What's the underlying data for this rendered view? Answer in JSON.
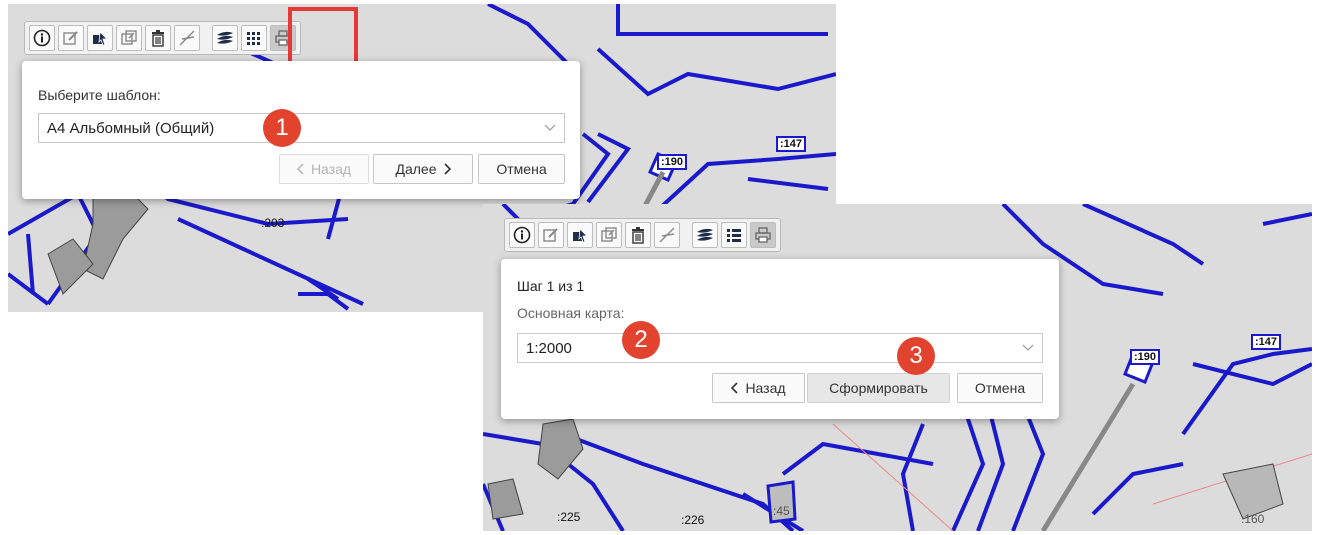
{
  "toolbar": {
    "buttons": [
      {
        "icon": "info-icon"
      },
      {
        "icon": "edit-icon"
      },
      {
        "icon": "select-object-icon"
      },
      {
        "icon": "export-icon"
      },
      {
        "icon": "trash-icon"
      },
      {
        "icon": "measure-icon"
      },
      {
        "icon": "layers-icon"
      },
      {
        "icon": "list-icon"
      },
      {
        "icon": "print-icon"
      }
    ]
  },
  "dialog1": {
    "label": "Выберите шаблон:",
    "template_value": "А4 Альбомный (Общий)",
    "back_label": "Назад",
    "next_label": "Далее",
    "cancel_label": "Отмена"
  },
  "dialog2": {
    "step_text": "Шаг 1 из 1",
    "map_label": "Основная карта:",
    "scale_value": "1:2000",
    "back_label": "Назад",
    "generate_label": "Сформировать",
    "cancel_label": "Отмена"
  },
  "badges": [
    "1",
    "2",
    "3"
  ],
  "map_labels_panel1": {
    "l190": ":190",
    "l147": ":147",
    "l203": ":203"
  },
  "map_labels_panel2": {
    "l190": ":190",
    "l147": ":147",
    "l225": ":225",
    "l226": ":226",
    "l45": ":45",
    "l160": ":160"
  },
  "colors": {
    "parcel_line": "#1a1acc",
    "highlight": "#e53935",
    "badge": "#e2432f",
    "map_bg": "#dcdcdc"
  }
}
